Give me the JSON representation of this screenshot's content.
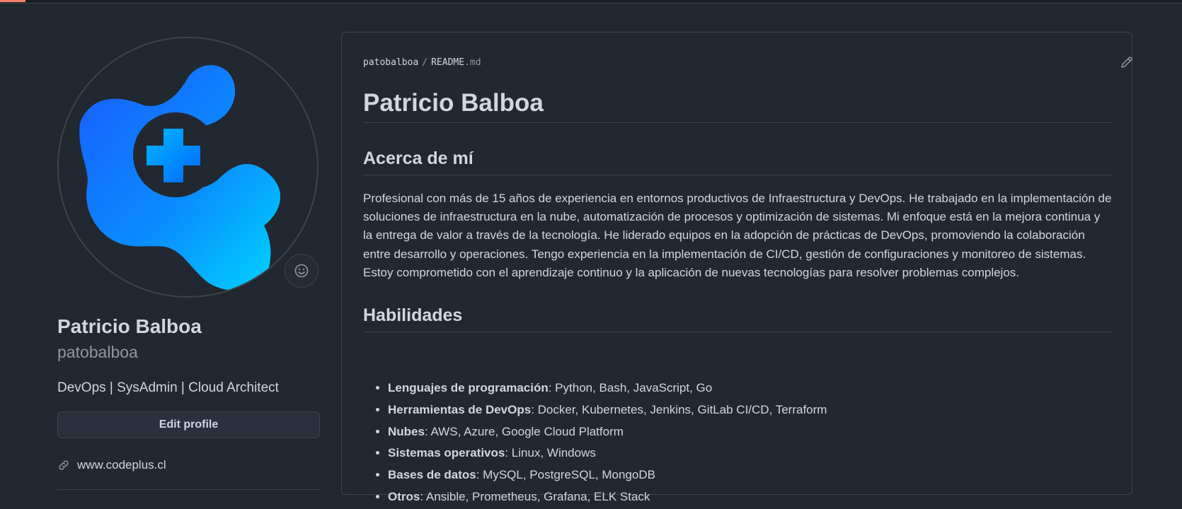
{
  "sidebar": {
    "full_name": "Patricio Balboa",
    "username": "patobalboa",
    "bio": "DevOps | SysAdmin | Cloud Architect",
    "edit_profile_label": "Edit profile",
    "website": "www.codeplus.cl",
    "icons": {
      "status": "smiley-icon",
      "website": "link-icon"
    }
  },
  "readme": {
    "path_owner": "patobalboa",
    "path_separator": "/",
    "path_file": "README",
    "path_ext": ".md",
    "edit_icon": "pencil-icon",
    "title": "Patricio Balboa",
    "about_heading": "Acerca de mí",
    "about_text": "Profesional con más de 15 años de experiencia en entornos productivos de Infraestructura y DevOps. He trabajado en la implementación de soluciones de infraestructura en la nube, automatización de procesos y optimización de sistemas. Mi enfoque está en la mejora continua y la entrega de valor a través de la tecnología. He liderado equipos en la adopción de prácticas de DevOps, promoviendo la colaboración entre desarrollo y operaciones. Tengo experiencia en la implementación de CI/CD, gestión de configuraciones y monitoreo de sistemas. Estoy comprometido con el aprendizaje continuo y la aplicación de nuevas tecnologías para resolver problemas complejos.",
    "skills_heading": "Habilidades",
    "skills": [
      {
        "label": "Lenguajes de programación",
        "value": ": Python, Bash, JavaScript, Go"
      },
      {
        "label": "Herramientas de DevOps",
        "value": ": Docker, Kubernetes, Jenkins, GitLab CI/CD, Terraform"
      },
      {
        "label": "Nubes",
        "value": ": AWS, Azure, Google Cloud Platform"
      },
      {
        "label": "Sistemas operativos",
        "value": ": Linux, Windows"
      },
      {
        "label": "Bases de datos",
        "value": ": MySQL, PostgreSQL, MongoDB"
      },
      {
        "label": "Otros",
        "value": ": Ansible, Prometheus, Grafana, ELK Stack"
      }
    ]
  },
  "colors": {
    "background": "#212830",
    "border": "#3d444d",
    "text": "#d1d7e0",
    "muted": "#9198a1",
    "logo_blue": "#1e6bff",
    "logo_cyan": "#00c8ff"
  }
}
